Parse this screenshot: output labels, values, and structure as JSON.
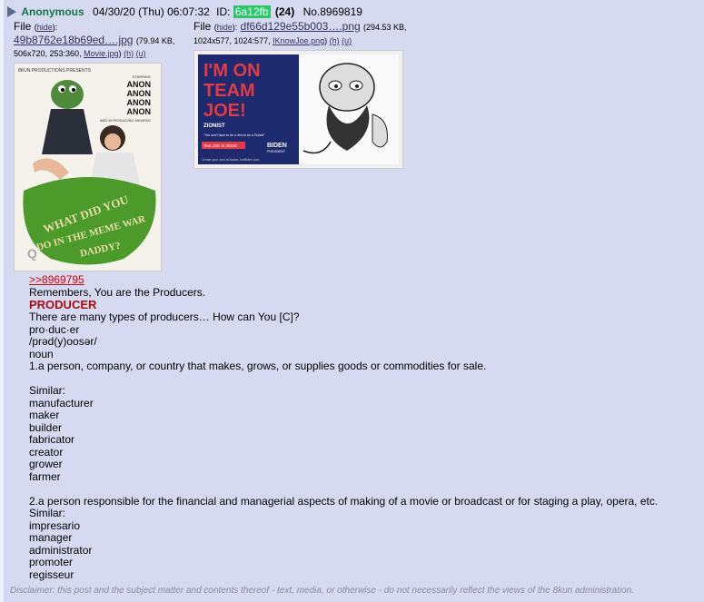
{
  "post": {
    "name": "Anonymous",
    "date": "04/30/20 (Thu) 06:07:32",
    "id_label": "ID:",
    "id_value": "6a12fb",
    "post_count": "(24)",
    "post_no": "No.8969819"
  },
  "files": [
    {
      "label": "File",
      "hide": "hide",
      "filename": "49b8762e18b69ed….jpg",
      "meta_a": "(79.94 KB,",
      "meta_b": "506x720, 253:360,",
      "orig_name": "Movie.jpg",
      "h": "(h)",
      "u": "(u)",
      "thumb": {
        "header": "8KUN PRODUCTIONS PRESENTS",
        "starring": "STARRING",
        "cast": [
          "ANON",
          "ANON",
          "ANON",
          "ANON"
        ],
        "and": "AND",
        "introducing": "AND INTRODUCING NEWFAG",
        "title": "WHAT DID YOU DO IN THE MEME WAR DADDY?",
        "q_mark": "Q"
      }
    },
    {
      "label": "File",
      "hide": "hide",
      "filename": "df66d129e55b003….png",
      "meta_a": "(294.53 KB,",
      "meta_b": "1024x577, 1024:577,",
      "orig_name": "IKnowJoe.png",
      "h": "(h)",
      "u": "(u)",
      "thumb": {
        "line1": "I'M ON",
        "line2": "TEAM",
        "line3": "JOE!",
        "sub": "ZIONIST",
        "quote": "\"You don't have to be a Jew to be a Zionist\"",
        "cta": "Text JOE to 30330",
        "brand": "BIDEN",
        "brand_sub": "PRESIDENT",
        "footer": "Create your own at Avatar.JoeBiden.com"
      }
    }
  ],
  "body": {
    "quote_link": ">>8969795",
    "lines_a": [
      "Remembers, You are the Producers."
    ],
    "heading": "PRODUCER",
    "lines_b": [
      "There are many types of producers… How can You [C]?",
      "pro·duc·er",
      "/prəd(y)oosər/",
      "noun",
      "1.a person, company, or country that makes, grows, or supplies goods or commodities for sale.",
      "",
      "Similar:",
      "manufacturer",
      "maker",
      "builder",
      "fabricator",
      "creator",
      "grower",
      "farmer",
      "",
      "2.a person responsible for the financial and managerial aspects of making of a movie or broadcast or for staging a play, opera, etc.",
      "Similar:",
      "impresario",
      "manager",
      "administrator",
      "promoter",
      "regisseur"
    ]
  },
  "disclaimer": "Disclaimer: this post and the subject matter and contents thereof - text, media, or otherwise - do not necessarily reflect the views of the 8kun administration.",
  "colors": {
    "name": "#117743",
    "id_badge": "#29c86b",
    "heading": "#af0a0f",
    "quote": "#dd0000",
    "post_bg": "#d6daf0",
    "team_joe_bg": "#1e3a8a"
  }
}
